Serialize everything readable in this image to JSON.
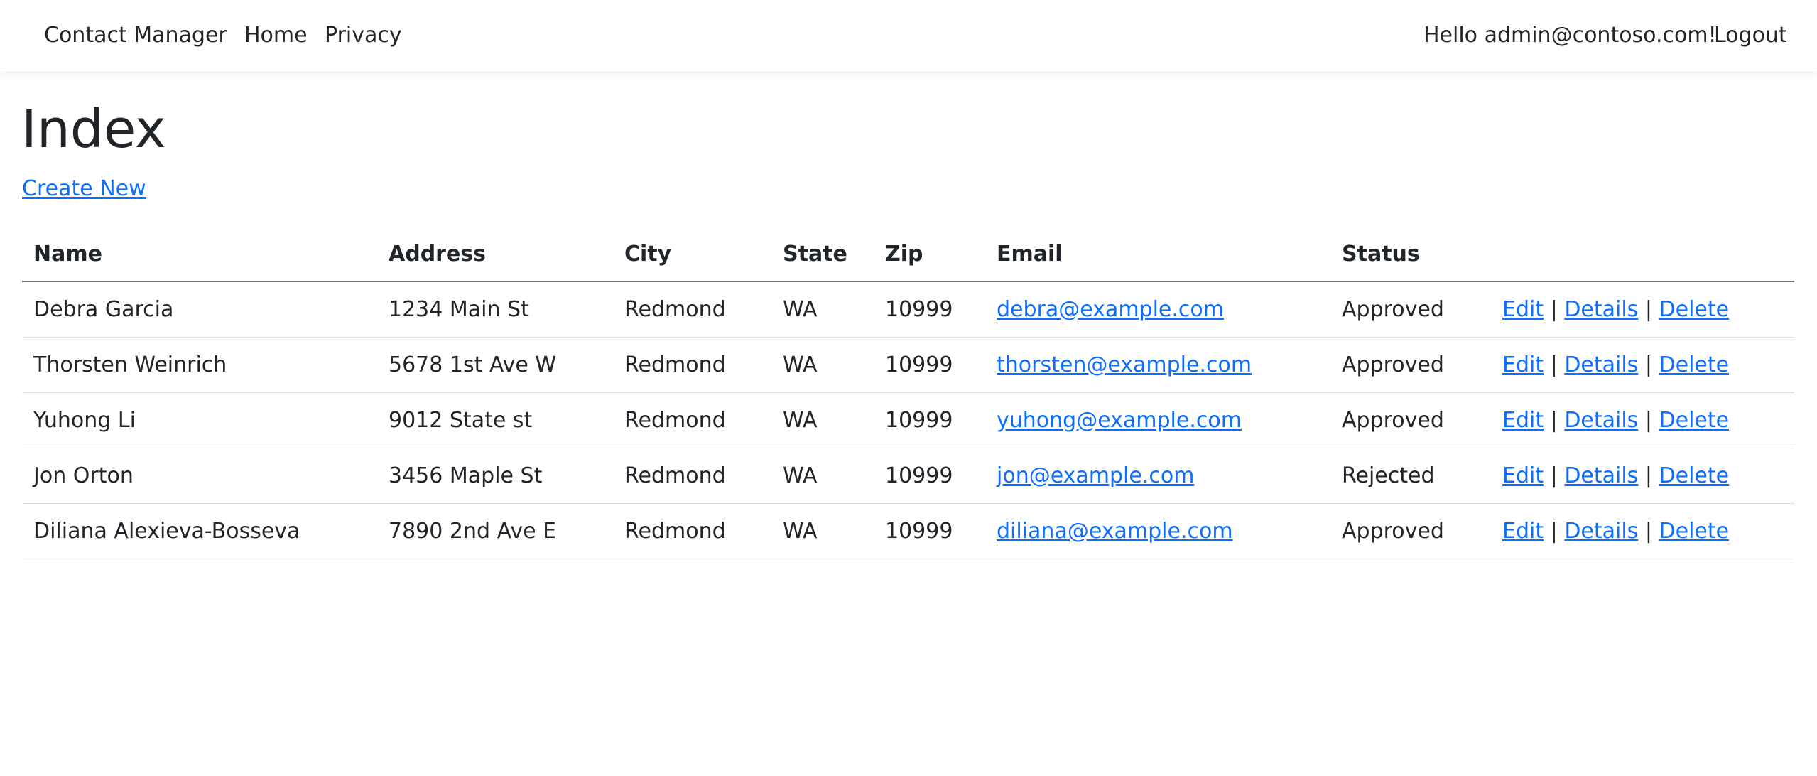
{
  "navbar": {
    "brand": "Contact Manager",
    "links": [
      "Home",
      "Privacy"
    ],
    "greeting": "Hello admin@contoso.com!",
    "logout": "Logout"
  },
  "page": {
    "title": "Index",
    "create_new": "Create New"
  },
  "table": {
    "headers": [
      "Name",
      "Address",
      "City",
      "State",
      "Zip",
      "Email",
      "Status",
      ""
    ],
    "action_labels": {
      "edit": "Edit",
      "details": "Details",
      "delete": "Delete",
      "separator": "|"
    },
    "rows": [
      {
        "name": "Debra Garcia",
        "address": "1234 Main St",
        "city": "Redmond",
        "state": "WA",
        "zip": "10999",
        "email": "debra@example.com",
        "status": "Approved"
      },
      {
        "name": "Thorsten Weinrich",
        "address": "5678 1st Ave W",
        "city": "Redmond",
        "state": "WA",
        "zip": "10999",
        "email": "thorsten@example.com",
        "status": "Approved"
      },
      {
        "name": "Yuhong Li",
        "address": "9012 State st",
        "city": "Redmond",
        "state": "WA",
        "zip": "10999",
        "email": "yuhong@example.com",
        "status": "Approved"
      },
      {
        "name": "Jon Orton",
        "address": "3456 Maple St",
        "city": "Redmond",
        "state": "WA",
        "zip": "10999",
        "email": "jon@example.com",
        "status": "Rejected"
      },
      {
        "name": "Diliana Alexieva-Bosseva",
        "address": "7890 2nd Ave E",
        "city": "Redmond",
        "state": "WA",
        "zip": "10999",
        "email": "diliana@example.com",
        "status": "Approved"
      }
    ]
  },
  "colors": {
    "link": "#0d6efd",
    "text": "#212529",
    "header_rule": "#6c757d",
    "row_rule": "#dee2e6"
  }
}
